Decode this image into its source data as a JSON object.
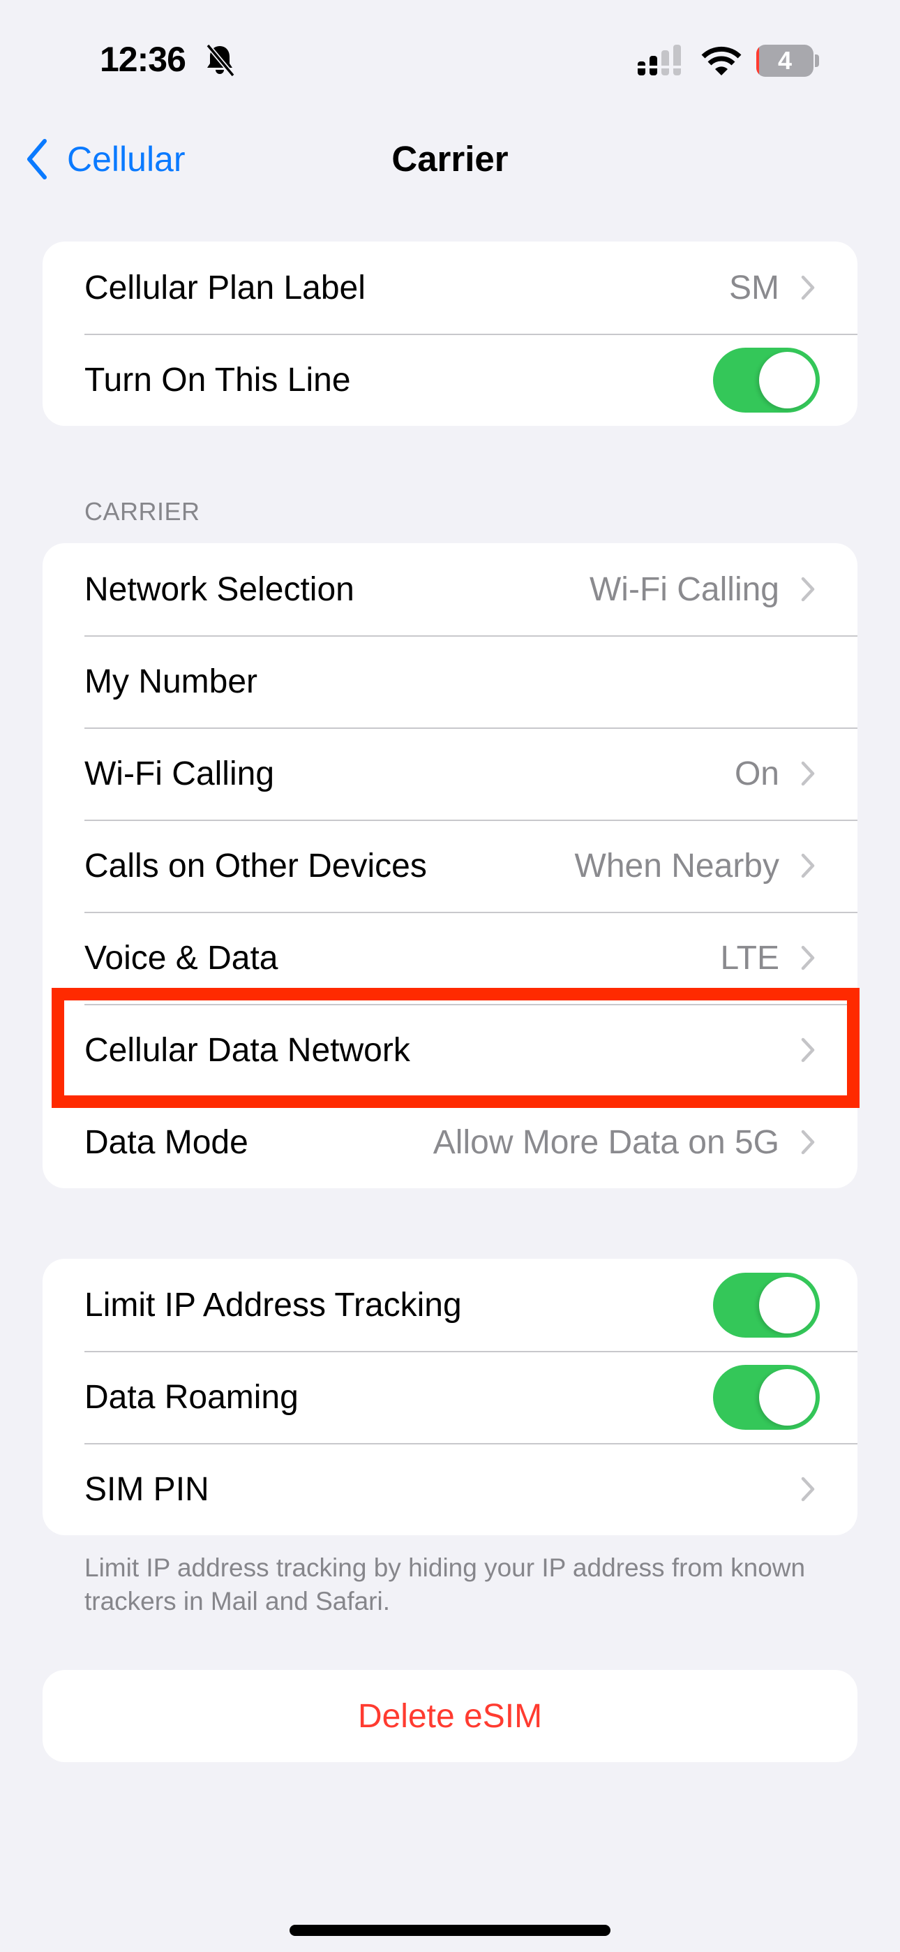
{
  "status_bar": {
    "time": "12:36",
    "silent_icon": "bell-slash-icon",
    "signal_icon": "cellular-signal-icon",
    "signal_bars_active": 2,
    "signal_bars_total": 4,
    "wifi_icon": "wifi-icon",
    "battery_icon": "battery-icon",
    "battery_percent": "4",
    "battery_low_color": "#ff3b30"
  },
  "nav": {
    "back_label": "Cellular",
    "back_icon": "chevron-left-icon",
    "title": "Carrier"
  },
  "groups": [
    {
      "rows": [
        {
          "label": "Cellular Plan Label",
          "value": "SM",
          "type": "link"
        },
        {
          "label": "Turn On This Line",
          "type": "toggle",
          "on": true
        }
      ]
    },
    {
      "header": "CARRIER",
      "rows": [
        {
          "label": "Network Selection",
          "value": "Wi-Fi Calling",
          "type": "link"
        },
        {
          "label": "My Number",
          "value": "",
          "type": "static"
        },
        {
          "label": "Wi-Fi Calling",
          "value": "On",
          "type": "link"
        },
        {
          "label": "Calls on Other Devices",
          "value": "When Nearby",
          "type": "link"
        },
        {
          "label": "Voice & Data",
          "value": "LTE",
          "type": "link"
        },
        {
          "label": "Cellular Data Network",
          "value": "",
          "type": "link",
          "highlighted": true
        },
        {
          "label": "Data Mode",
          "value": "Allow More Data on 5G",
          "type": "link"
        }
      ]
    },
    {
      "rows": [
        {
          "label": "Limit IP Address Tracking",
          "type": "toggle",
          "on": true
        },
        {
          "label": "Data Roaming",
          "type": "toggle",
          "on": true
        },
        {
          "label": "SIM PIN",
          "value": "",
          "type": "link"
        }
      ],
      "footer": "Limit IP address tracking by hiding your IP address from known trackers in Mail and Safari."
    },
    {
      "rows": [
        {
          "label": "Delete eSIM",
          "type": "destructive"
        }
      ]
    }
  ],
  "colors": {
    "accent": "#0a7aff",
    "toggle_on": "#34c759",
    "destructive": "#ff3b30",
    "highlight_box": "#ff2a00",
    "background": "#f2f2f7",
    "secondary_text": "#8a8a8e"
  }
}
